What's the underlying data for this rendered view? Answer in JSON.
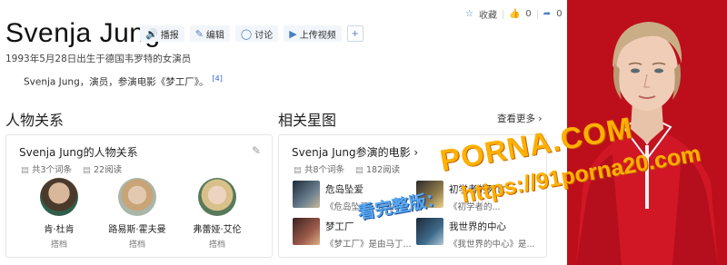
{
  "header": {
    "title": "Svenja Jung",
    "actions": [
      {
        "label": "播报",
        "icon": "speaker-icon"
      },
      {
        "label": "编辑",
        "icon": "edit-icon"
      },
      {
        "label": "讨论",
        "icon": "discuss-icon"
      },
      {
        "label": "上传视频",
        "icon": "video-icon"
      }
    ],
    "add_icon": "plus-icon"
  },
  "top_right": {
    "collect_label": "收藏",
    "like_count": "0",
    "share_count": "0"
  },
  "summary": {
    "subtitle": "1993年5月28日出生于德国韦罗特的女演员",
    "description": "Svenja Jung，演员，参演电影《梦工厂》。",
    "ref": "[4]"
  },
  "relations": {
    "section_title": "人物关系",
    "card_title": "Svenja Jung的人物关系",
    "entries": "共3个词条",
    "reads": "22阅读",
    "people": [
      {
        "name": "肯·杜肯",
        "role": "搭档"
      },
      {
        "name": "路易斯·霍夫曼",
        "role": "搭档"
      },
      {
        "name": "弗蕾娅·艾伦",
        "role": "搭档"
      }
    ]
  },
  "stars": {
    "section_title": "相关星图",
    "more_label": "查看更多",
    "card_title": "Svenja Jung参演的电影",
    "entries": "共8个词条",
    "reads": "182阅读",
    "movies": [
      {
        "name": "危岛坠爱",
        "sub": "《危岛坠爱》是由雷..."
      },
      {
        "name": "初学者的死亡",
        "sub": "《初学者的..."
      },
      {
        "name": "梦工厂",
        "sub": "《梦工厂》是由马丁..."
      },
      {
        "name": "我世界的中心",
        "sub": "《我世界的中心》是..."
      }
    ]
  },
  "watermark": {
    "line1": "PORNA.COM",
    "line2": "https://91porna20.com",
    "line3": "看完整版："
  }
}
